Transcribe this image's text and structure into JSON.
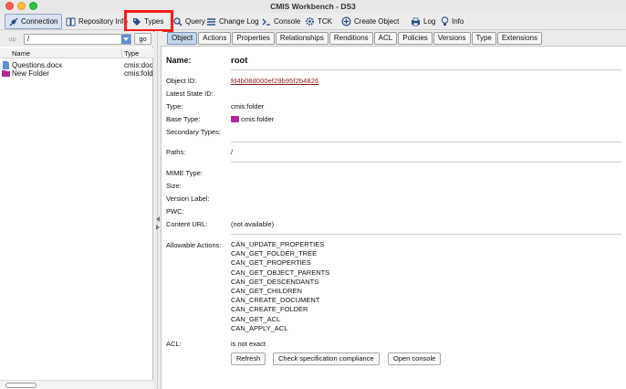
{
  "window": {
    "title": "CMIS Workbench - DS3"
  },
  "toolbar": {
    "connection": "Connection",
    "repository_info": "Repository Info",
    "types": "Types",
    "query": "Query",
    "change_log": "Change Log",
    "console": "Console",
    "tck": "TCK",
    "create_object": "Create Object",
    "log": "Log",
    "info": "Info"
  },
  "left_panel": {
    "up_label": "up",
    "path_value": "/",
    "go_label": "go",
    "columns": {
      "name": "Name",
      "type": "Type"
    },
    "items": [
      {
        "name": "Questions.docx",
        "type": "cmis:document",
        "icon": "document-icon"
      },
      {
        "name": "New Folder",
        "type": "cmis:folder",
        "icon": "folder-icon"
      }
    ]
  },
  "tabs": [
    "Object",
    "Actions",
    "Properties",
    "Relationships",
    "Renditions",
    "ACL",
    "Policies",
    "Versions",
    "Type",
    "Extensions"
  ],
  "selected_tab": "Object",
  "object": {
    "name_label": "Name:",
    "name_value": "root",
    "object_id_label": "Object ID:",
    "object_id_value": "fd4b08d000ef29b95f2b4826",
    "latest_state_id_label": "Latest State ID:",
    "type_label": "Type:",
    "type_value": "cmis:folder",
    "base_type_label": "Base Type:",
    "base_type_value": "cmis:folder",
    "secondary_types_label": "Secondary Types:",
    "paths_label": "Paths:",
    "paths_value": "/",
    "mime_type_label": "MIME Type:",
    "size_label": "Size:",
    "version_label_label": "Version Label:",
    "pwc_label": "PWC:",
    "content_url_label": "Content URL:",
    "content_url_value": "(not available)",
    "allowable_actions_label": "Allowable Actions:",
    "allowable_actions": [
      "CAN_UPDATE_PROPERTIES",
      "CAN_GET_FOLDER_TREE",
      "CAN_GET_PROPERTIES",
      "CAN_GET_OBJECT_PARENTS",
      "CAN_GET_DESCENDANTS",
      "CAN_GET_CHILDREN",
      "CAN_CREATE_DOCUMENT",
      "CAN_CREATE_FOLDER",
      "CAN_GET_ACL",
      "CAN_APPLY_ACL"
    ],
    "acl_label": "ACL:",
    "acl_value": "is not exact"
  },
  "buttons": {
    "refresh": "Refresh",
    "check_compliance": "Check specification compliance",
    "open_console": "Open console"
  },
  "colors": {
    "object_id": "#8b1a1a",
    "folder": "#b0279a",
    "selected_tab": "#c6d5ea",
    "highlight": "#ff1a1a"
  }
}
